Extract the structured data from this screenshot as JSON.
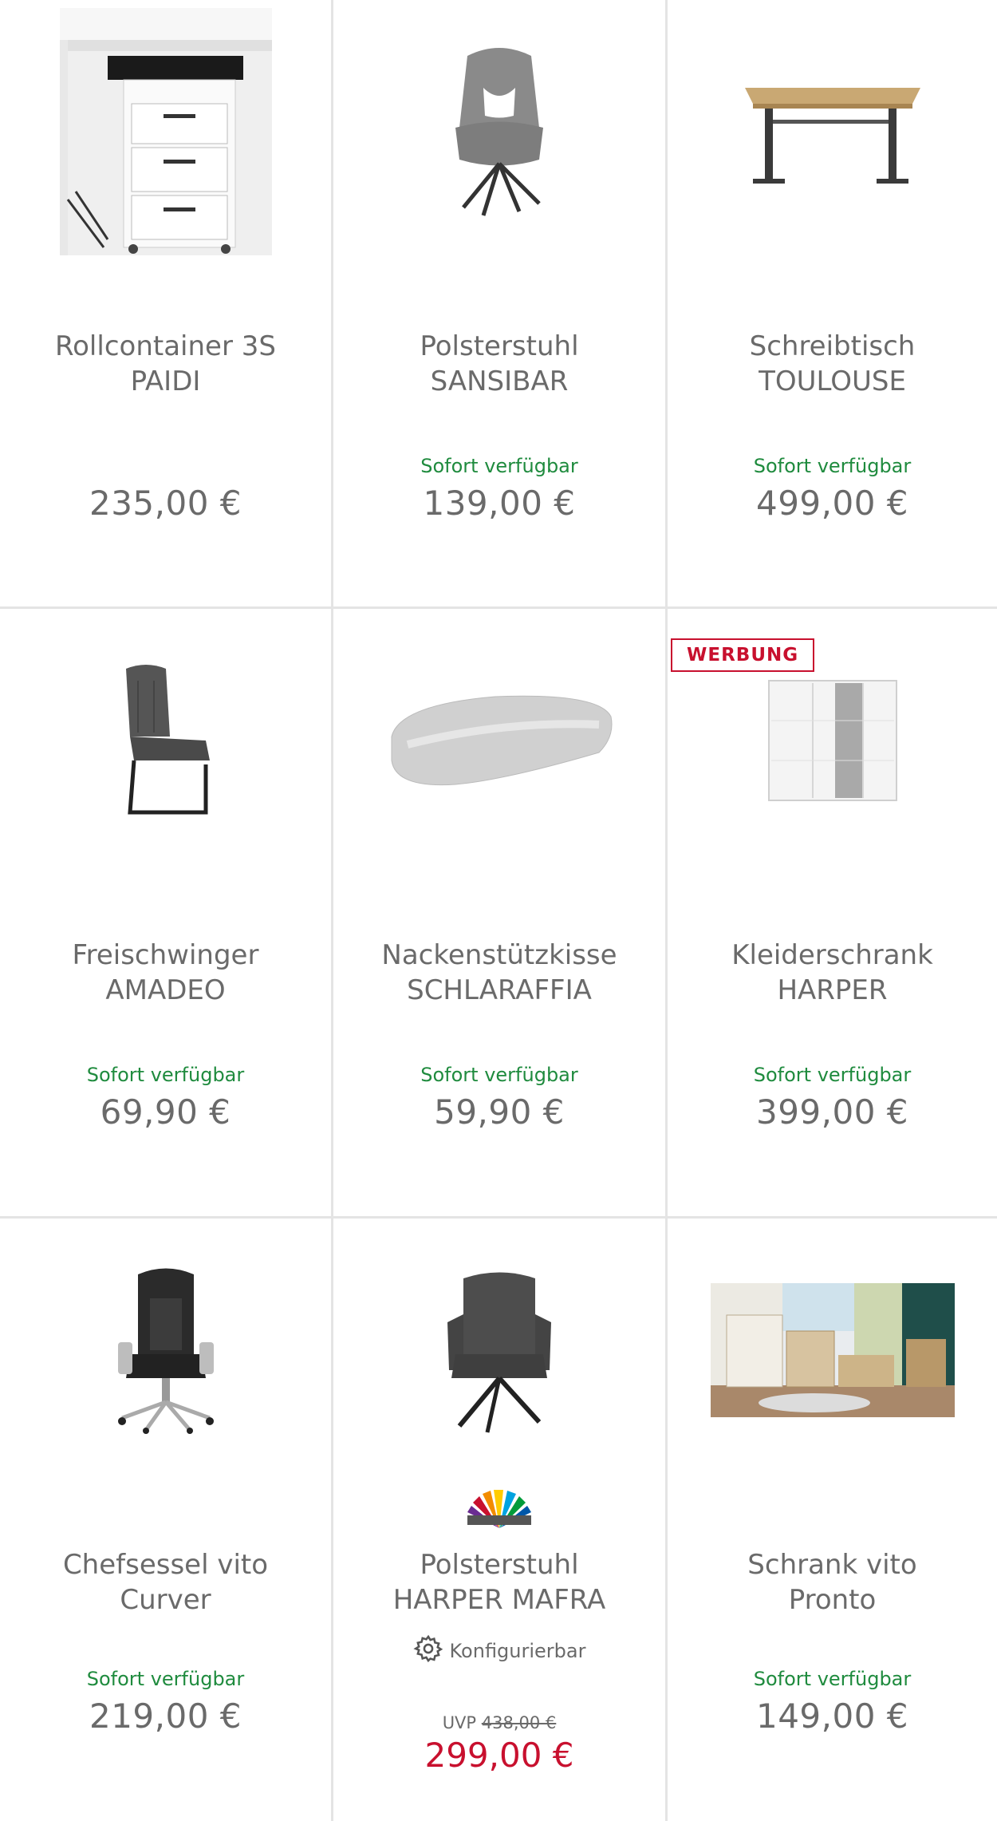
{
  "products": [
    {
      "name_line1": "Rollcontainer 3S",
      "name_line2": "PAIDI",
      "availability": "",
      "price": "235,00 €"
    },
    {
      "name_line1": "Polsterstuhl",
      "name_line2": "SANSIBAR",
      "availability": "Sofort verfügbar",
      "price": "139,00 €"
    },
    {
      "name_line1": "Schreibtisch",
      "name_line2": "TOULOUSE",
      "availability": "Sofort verfügbar",
      "price": "499,00 €"
    },
    {
      "name_line1": "Freischwinger",
      "name_line2": "AMADEO",
      "availability": "Sofort verfügbar",
      "price": "69,90 €"
    },
    {
      "name_line1": "Nackenstützkisse",
      "name_line2": "SCHLARAFFIA",
      "availability": "Sofort verfügbar",
      "price": "59,90 €"
    },
    {
      "name_line1": "Kleiderschrank",
      "name_line2": "HARPER",
      "availability": "Sofort verfügbar",
      "price": "399,00 €",
      "badge": "WERBUNG"
    },
    {
      "name_line1": "Chefsessel vito",
      "name_line2": "Curver",
      "availability": "Sofort verfügbar",
      "price": "219,00 €"
    },
    {
      "name_line1": "Polsterstuhl",
      "name_line2": "HARPER MAFRA",
      "config_label": "Konfigurierbar",
      "uvp_label": "UVP",
      "uvp_price": "438,00 €",
      "price": "299,00 €"
    },
    {
      "name_line1": "Schrank vito",
      "name_line2": "Pronto",
      "availability": "Sofort verfügbar",
      "price": "149,00 €"
    }
  ],
  "colors": {
    "availability": "#1f8b3e",
    "sale_price": "#c8102e",
    "badge": "#c8102e",
    "text": "#6a6a6a",
    "divider": "#e4e4e4"
  },
  "icons": {
    "config": "gear-icon",
    "brand": "rainbow-fan-logo"
  }
}
